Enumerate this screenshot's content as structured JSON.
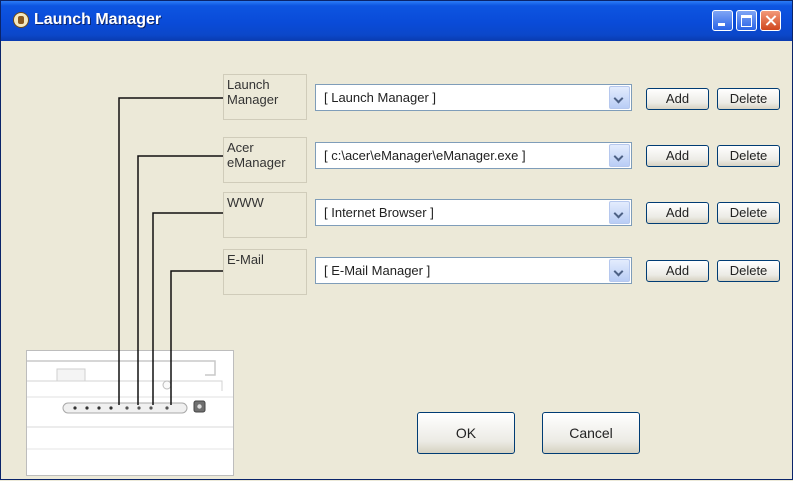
{
  "window": {
    "title": "Launch Manager"
  },
  "rows": [
    {
      "key_label": "Launch Manager",
      "selected": "[ Launch Manager ]",
      "add_label": "Add",
      "delete_label": "Delete"
    },
    {
      "key_label": "Acer eManager",
      "selected": "[ c:\\acer\\eManager\\eManager.exe ]",
      "add_label": "Add",
      "delete_label": "Delete"
    },
    {
      "key_label": "WWW",
      "selected": "[ Internet Browser ]",
      "add_label": "Add",
      "delete_label": "Delete"
    },
    {
      "key_label": "E-Mail",
      "selected": "[ E-Mail Manager ]",
      "add_label": "Add",
      "delete_label": "Delete"
    }
  ],
  "buttons": {
    "ok_label": "OK",
    "cancel_label": "Cancel"
  },
  "icons": {
    "app": "launch-manager-app-icon",
    "minimize": "minimize-icon",
    "maximize": "maximize-icon",
    "close": "close-icon",
    "dropdown": "chevron-down-icon"
  }
}
